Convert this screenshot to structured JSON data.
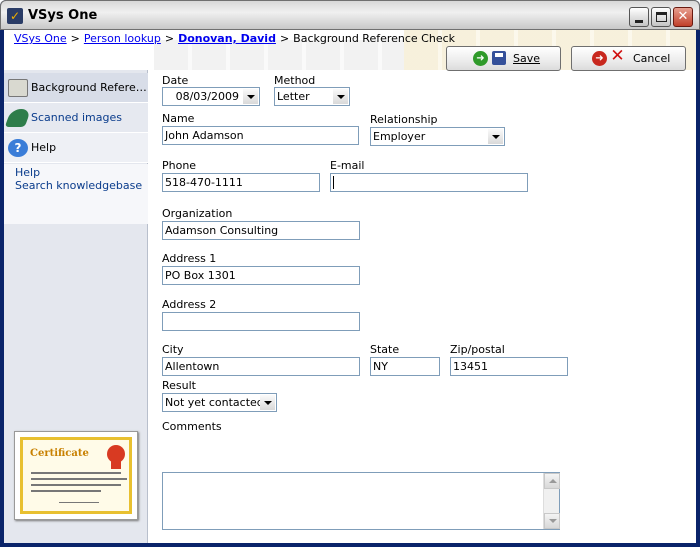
{
  "window": {
    "title": "VSys One"
  },
  "breadcrumb": [
    {
      "label": "VSys One"
    },
    {
      "label": "Person lookup"
    },
    {
      "label": "Donovan, David"
    },
    {
      "label": "Background Reference Check"
    }
  ],
  "toolbar": {
    "save_label": "Save",
    "cancel_label": "Cancel"
  },
  "sidebar": {
    "items": [
      {
        "label": "Background Reference Check",
        "icon": "printer-icon"
      },
      {
        "label": "Scanned images",
        "icon": "scanner-icon"
      },
      {
        "label": "Help",
        "icon": "help-icon"
      }
    ],
    "help_links": [
      "Help",
      "Search knowledgebase"
    ],
    "certificate_title": "Certificate"
  },
  "form": {
    "date": {
      "label": "Date",
      "value": "08/03/2009"
    },
    "method": {
      "label": "Method",
      "value": "Letter"
    },
    "name": {
      "label": "Name",
      "value": "John Adamson"
    },
    "relationship": {
      "label": "Relationship",
      "value": "Employer"
    },
    "phone": {
      "label": "Phone",
      "value": "518-470-1111"
    },
    "email": {
      "label": "E-mail",
      "value": ""
    },
    "organization": {
      "label": "Organization",
      "value": "Adamson Consulting"
    },
    "address1": {
      "label": "Address 1",
      "value": "PO Box 1301"
    },
    "address2": {
      "label": "Address 2",
      "value": ""
    },
    "city": {
      "label": "City",
      "value": "Allentown"
    },
    "state": {
      "label": "State",
      "value": "NY"
    },
    "zip": {
      "label": "Zip/postal",
      "value": "13451"
    },
    "result": {
      "label": "Result",
      "value": "Not yet contacted"
    },
    "comments": {
      "label": "Comments",
      "value": ""
    }
  },
  "colors": {
    "link": "#0000ee",
    "title_bar": "#d8d8d8",
    "sidebar_bg": "#e4e7ee"
  }
}
